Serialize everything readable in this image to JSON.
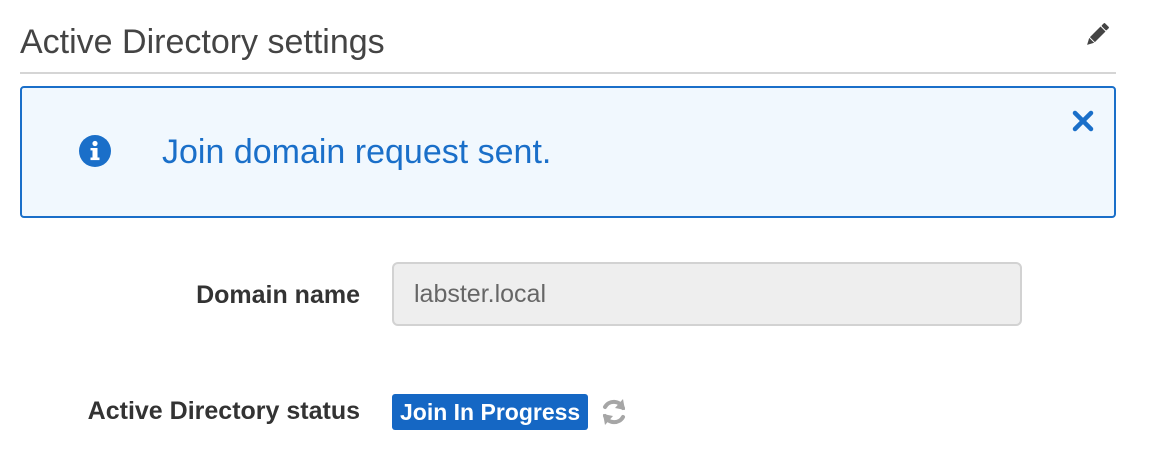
{
  "section": {
    "title": "Active Directory settings",
    "edit_icon": "pencil-icon"
  },
  "alert": {
    "icon": "info-circle-icon",
    "message": "Join domain request sent.",
    "close_icon": "close-icon",
    "color": "#1a6fc9",
    "background": "#f1f8fe"
  },
  "fields": {
    "domain_name": {
      "label": "Domain name",
      "value": "labster.local"
    },
    "status": {
      "label": "Active Directory status",
      "badge": "Join In Progress",
      "badge_color": "#1567c4",
      "icon": "refresh-icon"
    }
  }
}
